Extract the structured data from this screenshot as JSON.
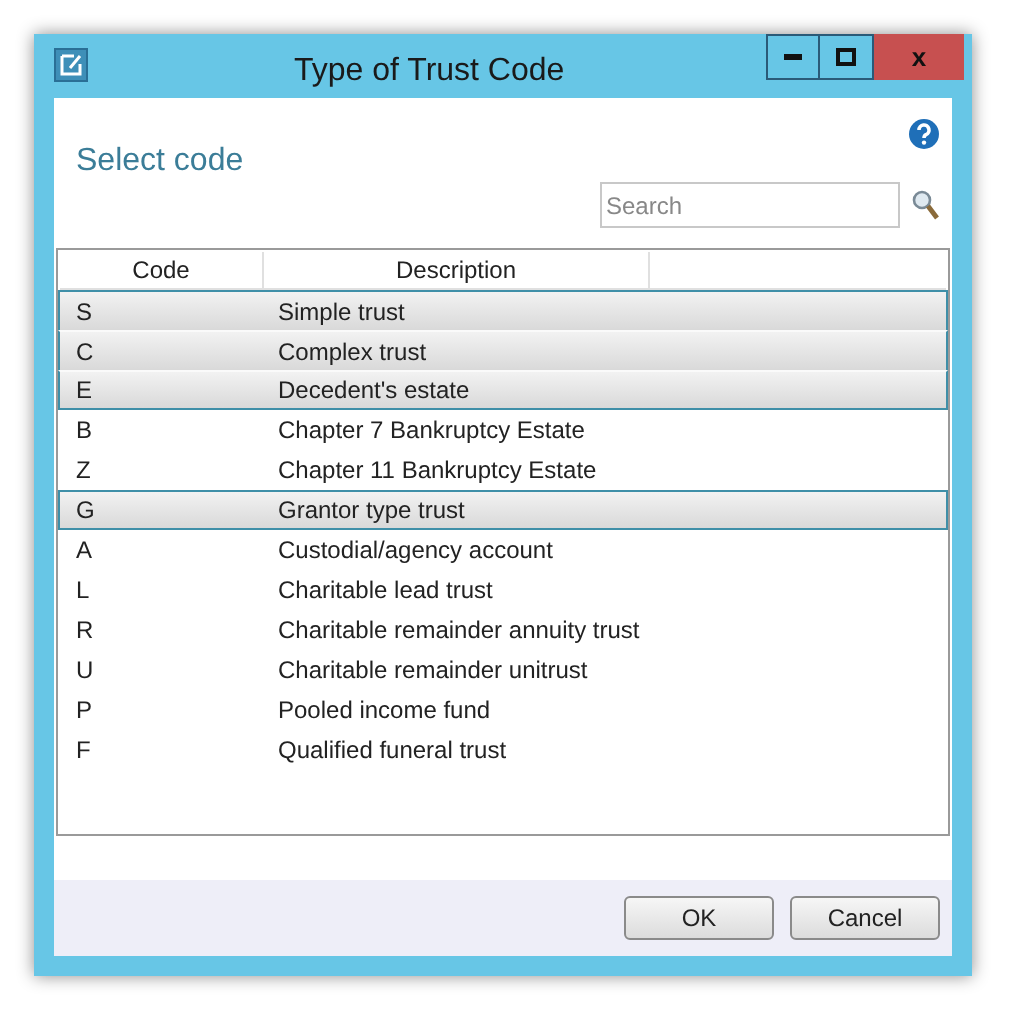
{
  "window": {
    "title": "Type of Trust Code",
    "close": "x"
  },
  "heading": "Select code",
  "search": {
    "placeholder": "Search"
  },
  "table": {
    "columns": [
      "Code",
      "Description"
    ],
    "rows": [
      {
        "code": "S",
        "description": "Simple trust",
        "selected": true
      },
      {
        "code": "C",
        "description": "Complex trust",
        "selected": true
      },
      {
        "code": "E",
        "description": "Decedent's estate",
        "selected": true
      },
      {
        "code": "B",
        "description": "Chapter 7 Bankruptcy Estate",
        "selected": false
      },
      {
        "code": "Z",
        "description": "Chapter 11 Bankruptcy Estate",
        "selected": false
      },
      {
        "code": "G",
        "description": "Grantor type trust",
        "selected": true
      },
      {
        "code": "A",
        "description": "Custodial/agency account",
        "selected": false
      },
      {
        "code": "L",
        "description": "Charitable lead trust",
        "selected": false
      },
      {
        "code": "R",
        "description": "Charitable remainder annuity trust",
        "selected": false
      },
      {
        "code": "U",
        "description": "Charitable remainder unitrust",
        "selected": false
      },
      {
        "code": "P",
        "description": "Pooled income fund",
        "selected": false
      },
      {
        "code": "F",
        "description": "Qualified funeral trust",
        "selected": false
      }
    ]
  },
  "buttons": [
    "OK",
    "Cancel"
  ]
}
